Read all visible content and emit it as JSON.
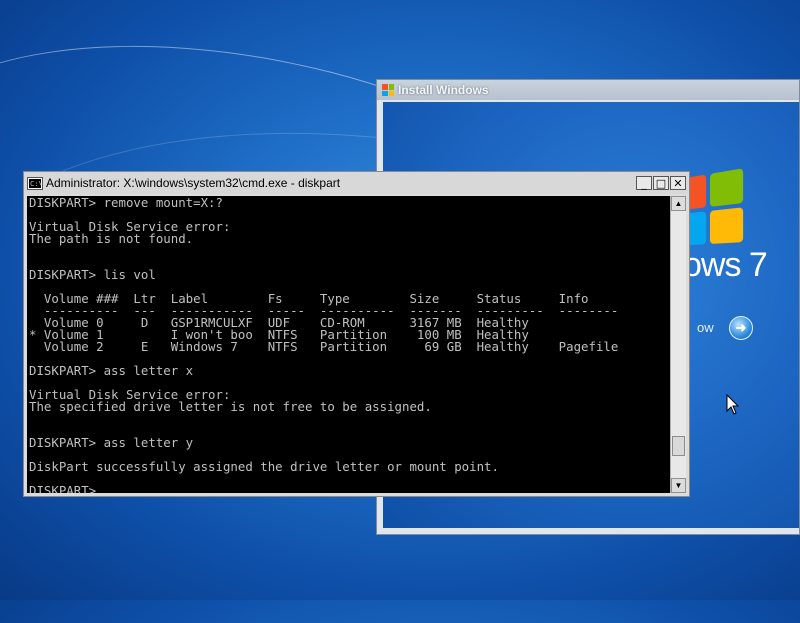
{
  "desktop": {
    "background_color": "#1f6fc8"
  },
  "install_window": {
    "title": "Install Windows",
    "brand_text": "ows 7",
    "install_now_partial": "ow",
    "arrow_icon": "arrow-right-icon"
  },
  "cmd_window": {
    "title": "Administrator: X:\\windows\\system32\\cmd.exe - diskpart",
    "icon_text": "C:\\",
    "controls": {
      "minimize": "_",
      "maximize": "□",
      "close": "✕"
    },
    "console_text": "DISKPART> remove mount=X:?\n\nVirtual Disk Service error:\nThe path is not found.\n\n\nDISKPART> lis vol\n\n  Volume ###  Ltr  Label        Fs     Type        Size     Status     Info\n  ----------  ---  -----------  -----  ----------  -------  ---------  --------\n  Volume 0     D   GSP1RMCULXF  UDF    CD-ROM      3167 MB  Healthy\n* Volume 1         I won't boo  NTFS   Partition    100 MB  Healthy\n  Volume 2     E   Windows 7    NTFS   Partition     69 GB  Healthy    Pagefile\n\nDISKPART> ass letter x\n\nVirtual Disk Service error:\nThe specified drive letter is not free to be assigned.\n\n\nDISKPART> ass letter y\n\nDiskPart successfully assigned the drive letter or mount point.\n\nDISKPART> ",
    "scroll_up": "▲",
    "scroll_down": "▼"
  },
  "colors": {
    "console_bg": "#000000",
    "console_fg": "#c0c0c0",
    "flag_red": "#f35325",
    "flag_green": "#81bc06",
    "flag_blue": "#05a6f0",
    "flag_yellow": "#ffba08"
  }
}
